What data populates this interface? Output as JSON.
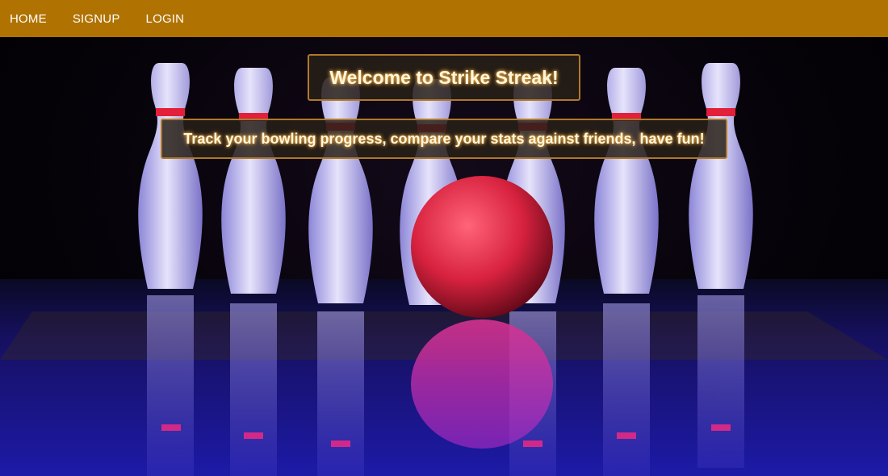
{
  "nav": {
    "items": [
      {
        "label": "HOME"
      },
      {
        "label": "SIGNUP"
      },
      {
        "label": "LOGIN"
      }
    ]
  },
  "hero": {
    "title": "Welcome to Strike Streak!",
    "tagline": "Track your bowling progress, compare your stats against friends, have fun!",
    "image": "bowling-pins-and-ball"
  },
  "colors": {
    "navbar": "#b07302",
    "box_border": "#b0782a",
    "text_glow": "#ffb74d",
    "ball": "#e0304a",
    "pins": "#c7c3f2",
    "lane": "#1a1690"
  }
}
